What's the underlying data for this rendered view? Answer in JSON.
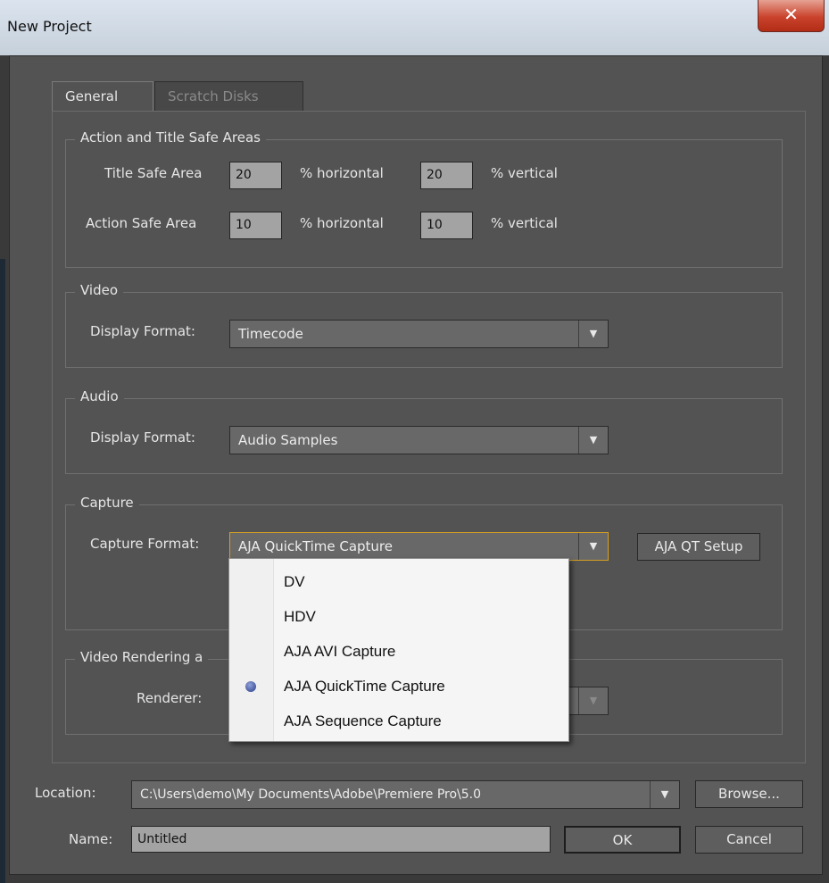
{
  "window": {
    "title": "New Project",
    "close_glyph": "✕"
  },
  "tabs": [
    {
      "label": "General",
      "active": true
    },
    {
      "label": "Scratch Disks",
      "active": false
    }
  ],
  "safe_areas": {
    "legend": "Action and Title Safe Areas",
    "title_label": "Title Safe Area",
    "title_horizontal": "20",
    "title_vertical": "20",
    "action_label": "Action Safe Area",
    "action_horizontal": "10",
    "action_vertical": "10",
    "horizontal_unit": "% horizontal",
    "vertical_unit": "% vertical"
  },
  "video": {
    "legend": "Video",
    "display_label": "Display Format:",
    "display_value": "Timecode"
  },
  "audio": {
    "legend": "Audio",
    "display_label": "Display Format:",
    "display_value": "Audio Samples"
  },
  "capture": {
    "legend": "Capture",
    "format_label": "Capture Format:",
    "format_value": "AJA QuickTime Capture",
    "setup_button": "AJA QT Setup",
    "options": [
      "DV",
      "HDV",
      "AJA AVI Capture",
      "AJA QuickTime Capture",
      "AJA Sequence Capture"
    ],
    "selected_index": 3
  },
  "rendering": {
    "legend": "Video Rendering a",
    "renderer_label": "Renderer:"
  },
  "footer": {
    "location_label": "Location:",
    "location_value": "C:\\Users\\demo\\My Documents\\Adobe\\Premiere Pro\\5.0",
    "browse_button": "Browse...",
    "name_label": "Name:",
    "name_value": "Untitled",
    "ok_button": "OK",
    "cancel_button": "Cancel"
  },
  "icons": {
    "dropdown_arrow": "▼",
    "radio_selected": "radio-dot-icon"
  },
  "colors": {
    "accent_focus": "#d7a021",
    "dialog_bg": "#535353",
    "close_red": "#c9422c"
  }
}
